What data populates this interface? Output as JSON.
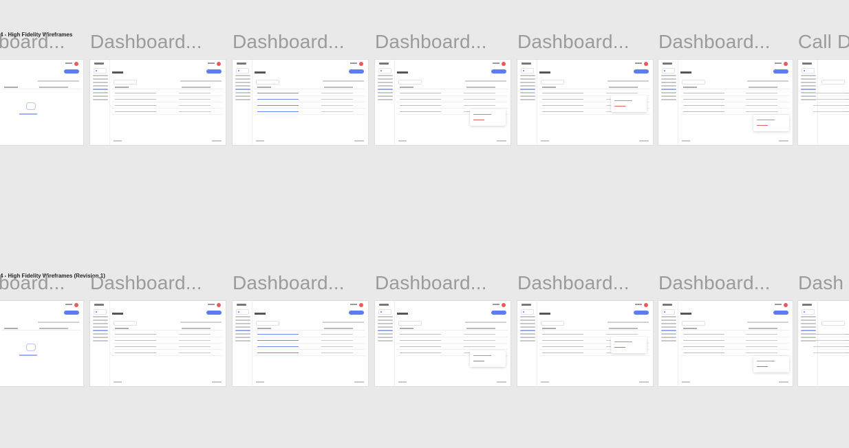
{
  "sections": [
    {
      "label": "4 - High Fidelity Wireframes",
      "frames": [
        {
          "title": "board...",
          "variant": "empty"
        },
        {
          "title": "Dashboard...",
          "variant": "list"
        },
        {
          "title": "Dashboard...",
          "variant": "selected"
        },
        {
          "title": "Dashboard...",
          "variant": "menu"
        },
        {
          "title": "Dashboard...",
          "variant": "menu"
        },
        {
          "title": "Dashboard...",
          "variant": "menu"
        },
        {
          "title": "Call D",
          "variant": "form"
        }
      ]
    },
    {
      "label": "4 - High Fidelity Wireframes (Revision 1)",
      "frames": [
        {
          "title": "board...",
          "variant": "empty"
        },
        {
          "title": "Dashboard...",
          "variant": "list"
        },
        {
          "title": "Dashboard...",
          "variant": "selected"
        },
        {
          "title": "Dashboard...",
          "variant": "menu"
        },
        {
          "title": "Dashboard...",
          "variant": "menu"
        },
        {
          "title": "Dashboard...",
          "variant": "menu"
        },
        {
          "title": "Dash",
          "variant": "form"
        }
      ]
    }
  ],
  "colors": {
    "canvas": "#e9e9e9",
    "frame_title": "#9b9b9b",
    "accent": "#5b7cf2",
    "danger": "#e95b5b"
  }
}
